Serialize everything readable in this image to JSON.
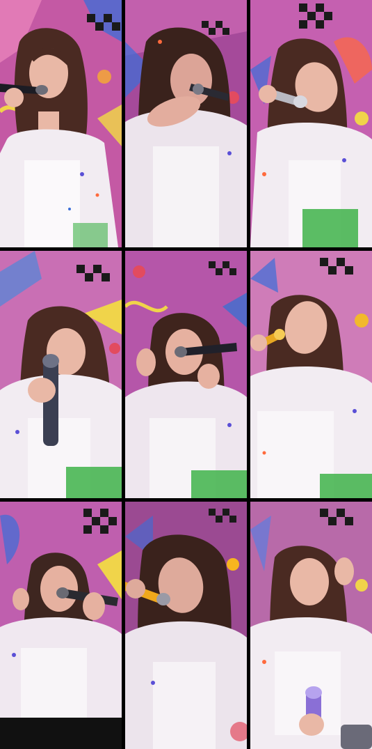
{
  "collage": {
    "rows": 3,
    "columns": 3,
    "background": "#000000",
    "tiles": [
      {
        "id": 1,
        "scene": "singer-mic-left-eyes-closed",
        "wall_color": "#d65aa8",
        "accent": "#3a7bd5",
        "mic_color": "#1c1c24"
      },
      {
        "id": 2,
        "scene": "singer-hand-over-face",
        "wall_color": "#a54a9a",
        "accent": "#e24b5f",
        "mic_color": "#2a2a33"
      },
      {
        "id": 3,
        "scene": "singer-head-tilted-silver-mic",
        "wall_color": "#c560b0",
        "accent": "#ff6a3d",
        "mic_color": "#b9b9c2"
      },
      {
        "id": 4,
        "scene": "singer-holding-mic-vertical",
        "wall_color": "#c96fb4",
        "accent": "#4f88d8",
        "mic_color": "#3b3f52"
      },
      {
        "id": 5,
        "scene": "singer-mic-center-hand-raised",
        "wall_color": "#b556a9",
        "accent": "#3d6fd0",
        "mic_color": "#20202a"
      },
      {
        "id": 6,
        "scene": "singer-gold-mic-looking-up",
        "wall_color": "#cf7cb8",
        "accent": "#f2b92c",
        "mic_color": "#e8a722"
      },
      {
        "id": 7,
        "scene": "singer-mic-right-eyes-closed",
        "wall_color": "#bf5fae",
        "accent": "#5a4fd6",
        "mic_color": "#2a2a30"
      },
      {
        "id": 8,
        "scene": "singer-gold-mic-leaning",
        "wall_color": "#9b4a92",
        "accent": "#f7b51f",
        "mic_color": "#f0a81c"
      },
      {
        "id": 9,
        "scene": "singer-hand-to-head-mic-low",
        "wall_color": "#b86aa9",
        "accent": "#5c7ee0",
        "mic_color": "#8a6fd6"
      }
    ],
    "palette": {
      "skin": "#e9b8a6",
      "hair": "#4a2a22",
      "top": "#f2ecf2",
      "checker_dark": "#1a1a1a",
      "checker_light": "#f4f4f4",
      "yellow": "#f0d44a",
      "blue": "#3b6ed8",
      "chips_green": "#3fb34a",
      "kiss_mark": "#c0283a"
    }
  }
}
